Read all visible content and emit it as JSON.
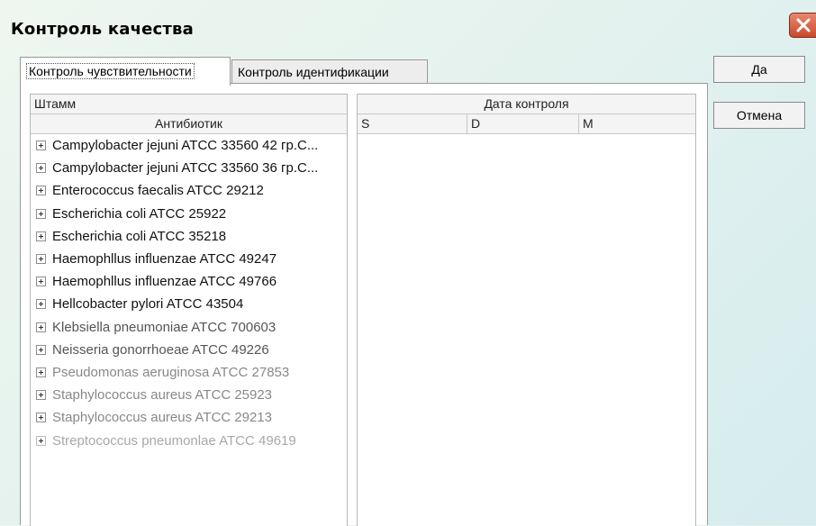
{
  "window": {
    "title": "Контроль качества",
    "close_icon": "close-icon"
  },
  "tabs": [
    {
      "label": "Контроль чувствительности",
      "active": true
    },
    {
      "label": "Контроль идентификации",
      "active": false
    }
  ],
  "left_grid": {
    "header_top": "Штамм",
    "header_sub": "Антибиотик",
    "rows": [
      "Campylobacter jejuni ATCC 33560  42 гр.С...",
      "Campylobacter jejuni ATCC 33560 36 гр.С...",
      "Enterococcus faecalis ATCC 29212",
      "Escherichia coli ATCC 25922",
      "Escherichia coli ATCC 35218",
      "Haemophllus influenzae ATCC 49247",
      "Haemophllus influenzae ATCC 49766",
      "Hellcobacter pylori ATCC 43504",
      "Klebsiella pneumoniae ATCC 700603",
      "Neisseria gonorrhoeae ATCC 49226",
      "Pseudomonas aeruginosa ATCC 27853",
      "Staphylococcus aureus ATCC 25923",
      "Staphylococcus aureus ATCC 29213",
      "Streptococcus pneumonlae ATCC 49619"
    ]
  },
  "right_grid": {
    "header_top": "Дата контроля",
    "columns": [
      "S",
      "D",
      "M"
    ]
  },
  "buttons": {
    "ok": "Да",
    "cancel": "Отмена"
  }
}
